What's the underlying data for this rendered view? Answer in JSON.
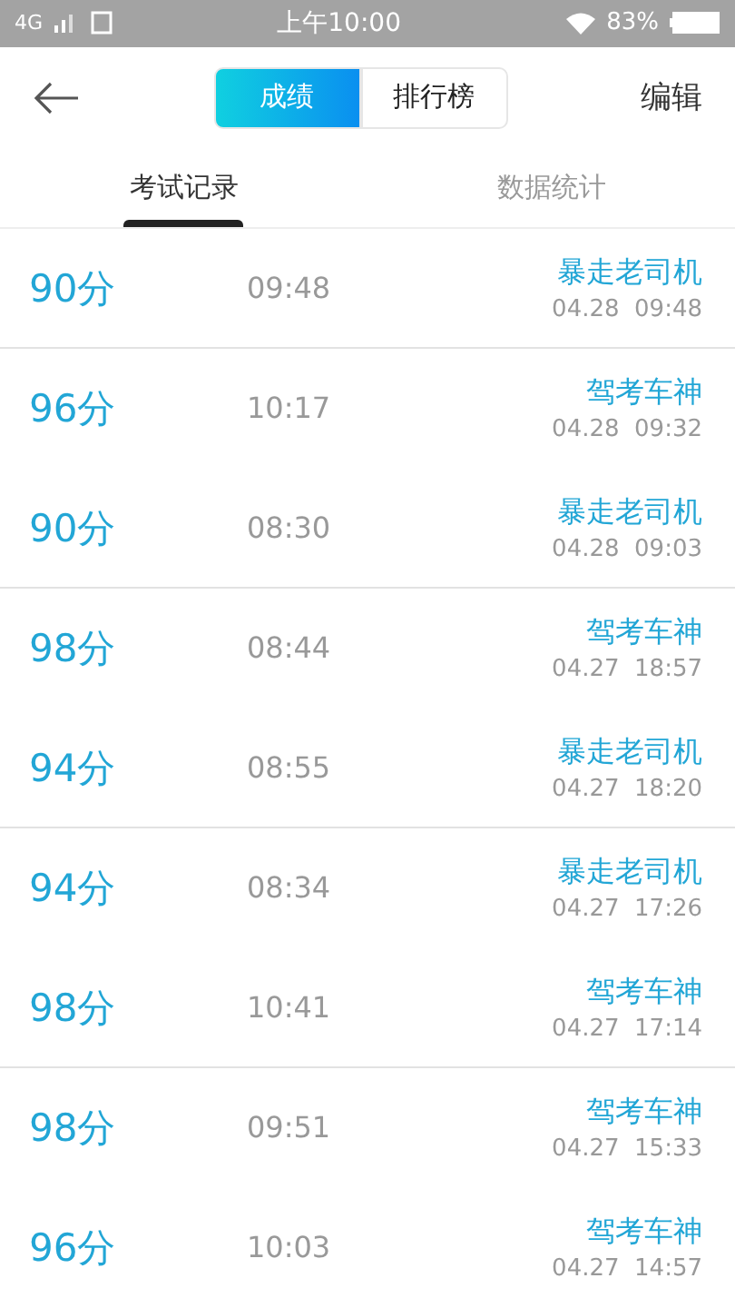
{
  "status_bar": {
    "network": "4G",
    "time": "上午10:00",
    "battery": "83%"
  },
  "header": {
    "segments": [
      {
        "label": "成绩",
        "selected": true
      },
      {
        "label": "排行榜",
        "selected": false
      }
    ],
    "action": "编辑"
  },
  "tabs": [
    {
      "label": "考试记录",
      "selected": true
    },
    {
      "label": "数据统计",
      "selected": false
    }
  ],
  "records": [
    {
      "score": "90分",
      "duration": "09:48",
      "name": "暴走老司机",
      "date": "04.28  09:48",
      "divider_after": true
    },
    {
      "score": "96分",
      "duration": "10:17",
      "name": "驾考车神",
      "date": "04.28  09:32",
      "divider_after": false
    },
    {
      "score": "90分",
      "duration": "08:30",
      "name": "暴走老司机",
      "date": "04.28  09:03",
      "divider_after": true
    },
    {
      "score": "98分",
      "duration": "08:44",
      "name": "驾考车神",
      "date": "04.27  18:57",
      "divider_after": false
    },
    {
      "score": "94分",
      "duration": "08:55",
      "name": "暴走老司机",
      "date": "04.27  18:20",
      "divider_after": true
    },
    {
      "score": "94分",
      "duration": "08:34",
      "name": "暴走老司机",
      "date": "04.27  17:26",
      "divider_after": false
    },
    {
      "score": "98分",
      "duration": "10:41",
      "name": "驾考车神",
      "date": "04.27  17:14",
      "divider_after": true
    },
    {
      "score": "98分",
      "duration": "09:51",
      "name": "驾考车神",
      "date": "04.27  15:33",
      "divider_after": false
    },
    {
      "score": "96分",
      "duration": "10:03",
      "name": "驾考车神",
      "date": "04.27  14:57",
      "divider_after": false
    }
  ]
}
